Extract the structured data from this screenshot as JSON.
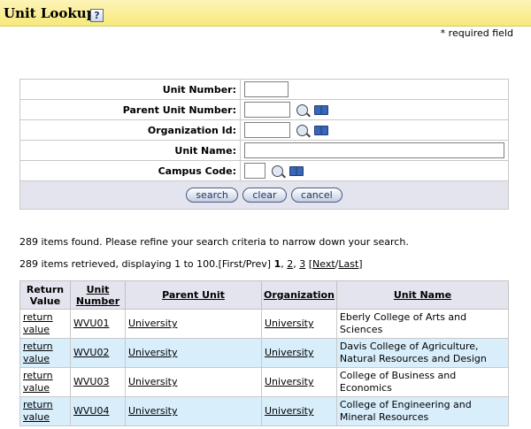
{
  "header": {
    "title": "Unit Lookup",
    "help_icon": "?"
  },
  "required_note": "* required field",
  "search_form": {
    "fields": [
      {
        "label": "Unit Number:",
        "value": "",
        "lookup": false
      },
      {
        "label": "Parent Unit Number:",
        "value": "",
        "lookup": true
      },
      {
        "label": "Organization Id:",
        "value": "",
        "lookup": true
      },
      {
        "label": "Unit Name:",
        "value": "",
        "lookup": false
      },
      {
        "label": "Campus Code:",
        "value": "",
        "lookup": true
      }
    ],
    "buttons": {
      "search": "search",
      "clear": "clear",
      "cancel": "cancel"
    }
  },
  "messages": {
    "found": "289 items found.  Please refine your search criteria to narrow down your search.",
    "retrieved_prefix": "289 items retrieved, displaying 1 to 100.",
    "first_prev": "[First/Prev]",
    "page_current": "1",
    "page_2": "2",
    "page_3": "3",
    "bracket_open": "[",
    "next": "Next",
    "slash": "/",
    "last": "Last",
    "bracket_close": "]"
  },
  "results": {
    "headers": {
      "return_value": "Return Value",
      "unit_number": "Unit Number",
      "parent_unit": "Parent Unit",
      "organization": "Organization",
      "unit_name": "Unit Name"
    },
    "rows": [
      {
        "return": "return value",
        "unit_number": "WVU01",
        "parent_unit": "University",
        "organization": "University",
        "unit_name": "Eberly College of Arts and Sciences"
      },
      {
        "return": "return value",
        "unit_number": "WVU02",
        "parent_unit": "University",
        "organization": "University",
        "unit_name": "Davis College of Agriculture, Natural Resources and Design"
      },
      {
        "return": "return value",
        "unit_number": "WVU03",
        "parent_unit": "University",
        "organization": "University",
        "unit_name": "College of Business and Economics"
      },
      {
        "return": "return value",
        "unit_number": "WVU04",
        "parent_unit": "University",
        "organization": "University",
        "unit_name": "College of Engineering and Mineral Resources"
      }
    ]
  },
  "colors": {
    "header_bg": "#f7e97a",
    "alt_row": "#d8eefb",
    "table_header": "#e4e4ef"
  }
}
